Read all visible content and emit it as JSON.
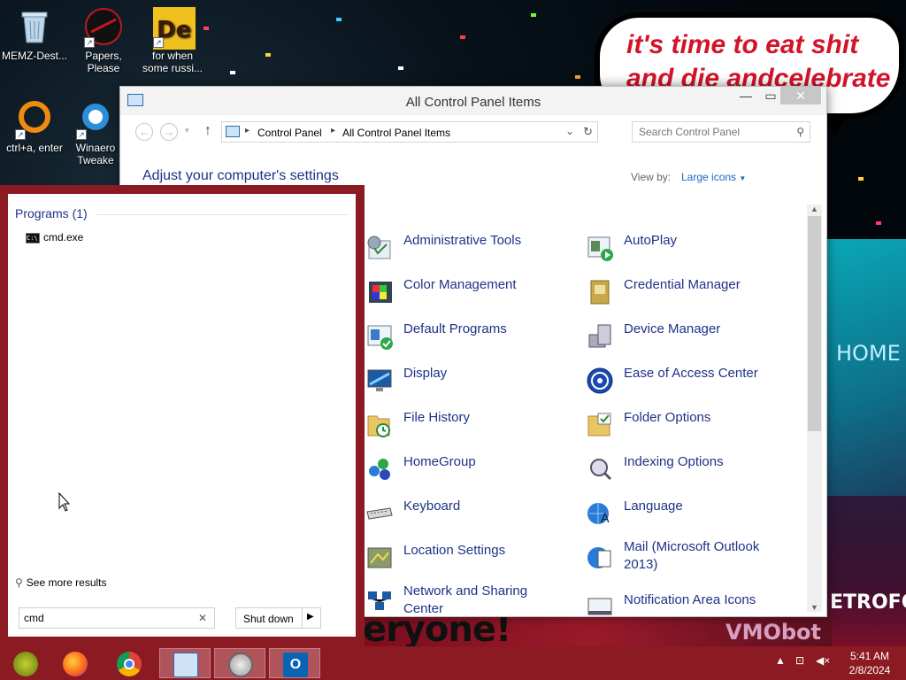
{
  "desktop": {
    "icons": [
      {
        "label": "MEMZ-Dest...",
        "icon": "recycle-bin-icon"
      },
      {
        "label": "Papers, Please",
        "icon": "papers-please-icon"
      },
      {
        "label": "for when some russi...",
        "icon": "de-app-icon"
      },
      {
        "label": "ctrl+a, enter",
        "icon": "orange-ring-icon"
      },
      {
        "label": "Winaero Tweake",
        "icon": "winaero-tweaker-icon"
      }
    ],
    "speech_bubble": "it's time to eat shit and die andcelebrate",
    "wallpaper_text_bottom": "eryone!",
    "wallpaper_text_right": "ETROFOS",
    "wallpaper_text_home": "HOME",
    "wallpaper_text_vmo": "VMObot"
  },
  "control_panel": {
    "title": "All Control Panel Items",
    "breadcrumb": [
      "Control Panel",
      "All Control Panel Items"
    ],
    "search_placeholder": "Search Control Panel",
    "heading": "Adjust your computer's settings",
    "view_by_label": "View by:",
    "view_by_value": "Large icons",
    "items_left": [
      {
        "label": "Administrative Tools",
        "icon": "administrative-tools-icon"
      },
      {
        "label": "Color Management",
        "icon": "color-management-icon"
      },
      {
        "label": "Default Programs",
        "icon": "default-programs-icon"
      },
      {
        "label": "Display",
        "icon": "display-icon"
      },
      {
        "label": "File History",
        "icon": "file-history-icon"
      },
      {
        "label": "HomeGroup",
        "icon": "homegroup-icon"
      },
      {
        "label": "Keyboard",
        "icon": "keyboard-icon"
      },
      {
        "label": "Location Settings",
        "icon": "location-settings-icon"
      },
      {
        "label": "Network and Sharing Center",
        "icon": "network-sharing-icon"
      }
    ],
    "items_right": [
      {
        "label": "AutoPlay",
        "icon": "autoplay-icon"
      },
      {
        "label": "Credential Manager",
        "icon": "credential-manager-icon"
      },
      {
        "label": "Device Manager",
        "icon": "device-manager-icon"
      },
      {
        "label": "Ease of Access Center",
        "icon": "ease-of-access-icon"
      },
      {
        "label": "Folder Options",
        "icon": "folder-options-icon"
      },
      {
        "label": "Indexing Options",
        "icon": "indexing-options-icon"
      },
      {
        "label": "Language",
        "icon": "language-icon"
      },
      {
        "label": "Mail (Microsoft Outlook 2013)",
        "icon": "mail-icon"
      },
      {
        "label": "Notification Area Icons",
        "icon": "notification-area-icon"
      }
    ]
  },
  "start_menu": {
    "group_title": "Programs (1)",
    "result": "cmd.exe",
    "see_more": "See more results",
    "search_value": "cmd",
    "shutdown_label": "Shut down"
  },
  "taskbar": {
    "apps": [
      "app-icon",
      "firefox-icon",
      "chrome-icon",
      "control-panel-icon",
      "safari-icon",
      "outlook-icon"
    ],
    "time": "5:41 AM",
    "date": "2/8/2024"
  },
  "colors": {
    "accent_red": "#8c1a22",
    "link_blue": "#1e3287",
    "speech_red": "#d4132a"
  }
}
